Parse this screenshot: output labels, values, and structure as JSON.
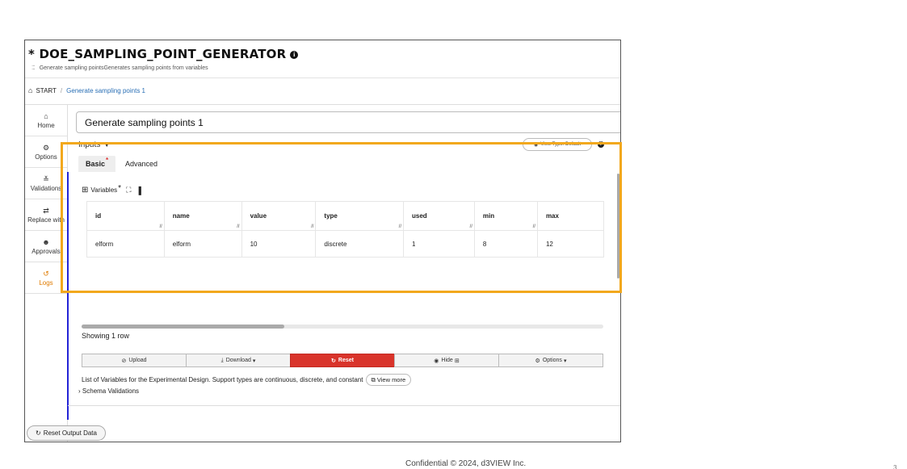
{
  "app": {
    "title": "* DOE_SAMPLING_POINT_GENERATOR",
    "subtitle": "Generate sampling pointsGenerates sampling points from variables"
  },
  "breadcrumb": {
    "root": "START",
    "separator": "/",
    "current": "Generate sampling points 1"
  },
  "sidebar": {
    "items": [
      {
        "label": "Home",
        "icon": "home-icon"
      },
      {
        "label": "Options",
        "icon": "gear-icon"
      },
      {
        "label": "Validations",
        "icon": "double-check-icon"
      },
      {
        "label": "Replace with",
        "icon": "swap-icon"
      },
      {
        "label": "Approvals",
        "icon": "user-check-icon"
      },
      {
        "label": "Logs",
        "icon": "history-icon",
        "active": true
      }
    ]
  },
  "name_field": {
    "value": "Generate sampling points 1"
  },
  "inputs": {
    "header": "Inputs",
    "view_type": "View Type: Default",
    "tabs": [
      {
        "label": "Basic",
        "required": "*",
        "active": true
      },
      {
        "label": "Advanced"
      }
    ]
  },
  "variables": {
    "label": "Variables",
    "required": "*",
    "columns": [
      "id",
      "name",
      "value",
      "type",
      "used",
      "min",
      "max"
    ],
    "rows": [
      [
        "elform",
        "elform",
        "10",
        "discrete",
        "1",
        "8",
        "12"
      ]
    ],
    "row_count_text": "Showing 1 row"
  },
  "toolbar": {
    "upload": "Upload",
    "download": "Download",
    "reset": "Reset",
    "hide": "Hide",
    "options": "Options"
  },
  "description": {
    "text": "List of Variables for the Experimental Design. Support types are continuous, discrete, and constant",
    "view_more": "View more",
    "schema": "Schema Validations"
  },
  "reset_output": "Reset Output Data",
  "footer": "Confidential © 2024, d3VIEW Inc.",
  "page_number": "3",
  "colors": {
    "highlight": "#f2a81d",
    "reset_button": "#d9342b",
    "link": "#2a6fb5",
    "active_nav": "#e07b00",
    "left_rule": "#2424d6"
  }
}
